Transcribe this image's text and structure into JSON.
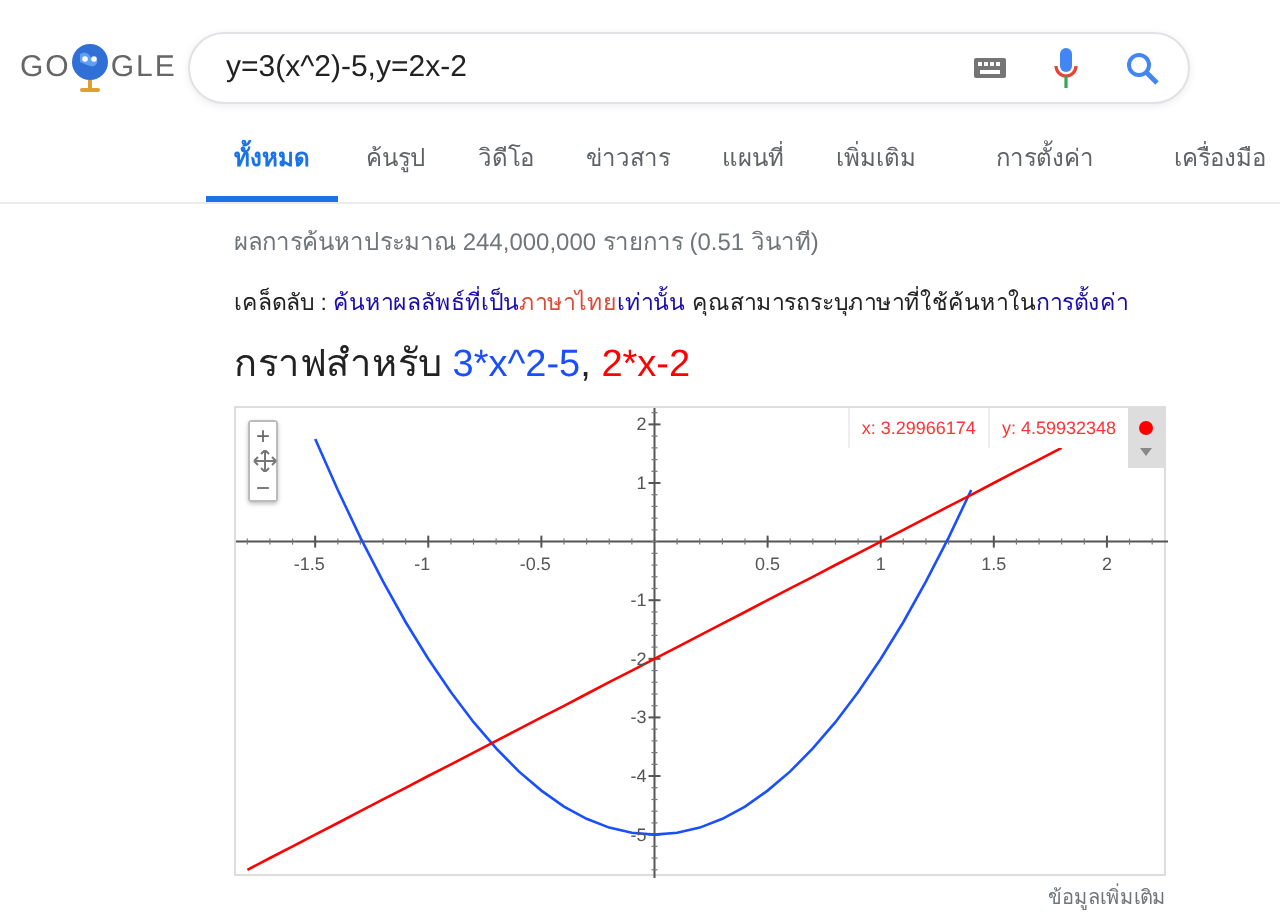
{
  "logo": {
    "left": "GO",
    "right": "GLE"
  },
  "search": {
    "value": "y=3(x^2)-5,y=2x-2"
  },
  "tabs": [
    {
      "label": "ทั้งหมด",
      "selected": true
    },
    {
      "label": "ค้นรูป",
      "selected": false
    },
    {
      "label": "วิดีโอ",
      "selected": false
    },
    {
      "label": "ข่าวสาร",
      "selected": false
    },
    {
      "label": "แผนที่",
      "selected": false
    },
    {
      "label": "เพิ่มเติม",
      "selected": false
    }
  ],
  "tools": [
    "การตั้งค่า",
    "เครื่องมือ"
  ],
  "result_stats": "ผลการค้นหาประมาณ 244,000,000 รายการ (0.51 วินาที)",
  "tip": {
    "label": "เคล็ดลับ : ",
    "link_before": "ค้นหาผลลัพธ์ที่เป็น",
    "link_highlight": "ภาษาไทย",
    "link_after": "เท่านั้น",
    "text": " คุณสามารถระบุภาษาที่ใช้ค้นหาใน",
    "settings_link": "การตั้งค่า"
  },
  "graph": {
    "heading": "กราฟสำหรับ",
    "separator": ", ",
    "zoom_in": "+",
    "zoom_out": "−",
    "cursor": {
      "x": "x: 3.29966174",
      "y": "y: 4.59932348"
    },
    "chart_data": {
      "type": "line",
      "x": [
        -1.8,
        -1.7,
        -1.6,
        -1.5,
        -1.4,
        -1.3,
        -1.2,
        -1.1,
        -1,
        -0.9,
        -0.8,
        -0.7,
        -0.6,
        -0.5,
        -0.4,
        -0.3,
        -0.2,
        -0.1,
        0,
        0.1,
        0.2,
        0.3,
        0.4,
        0.5,
        0.6,
        0.7,
        0.8,
        0.9,
        1,
        1.1,
        1.2,
        1.3,
        1.4,
        1.5,
        1.6,
        1.7,
        1.8
      ],
      "series": [
        {
          "name": "3*x^2-5",
          "color": "#1a4fff",
          "values": [
            null,
            null,
            null,
            1.75,
            0.88,
            0.07,
            -0.68,
            -1.37,
            -2,
            -2.57,
            -3.08,
            -3.53,
            -3.92,
            -4.25,
            -4.52,
            -4.73,
            -4.88,
            -4.97,
            -5,
            -4.97,
            -4.88,
            -4.73,
            -4.52,
            -4.25,
            -3.92,
            -3.53,
            -3.08,
            -2.57,
            -2,
            -1.37,
            -0.68,
            0.07,
            0.88,
            null,
            null,
            null,
            null
          ]
        },
        {
          "name": "2*x-2",
          "color": "#ff0000",
          "values": [
            -5.6,
            -5.4,
            -5.2,
            -5,
            -4.8,
            -4.6,
            -4.4,
            -4.2,
            -4,
            -3.8,
            -3.6,
            -3.4,
            -3.2,
            -3,
            -2.8,
            -2.6,
            -2.4,
            -2.2,
            -2,
            -1.8,
            -1.6,
            -1.4,
            -1.2,
            -1,
            -0.8,
            -0.6,
            -0.4,
            -0.2,
            0,
            0.2,
            0.4,
            0.6,
            0.8,
            1,
            1.2,
            1.4,
            1.6
          ]
        }
      ],
      "xlim": [
        -1.85,
        2.27
      ],
      "ylim": [
        -5.74,
        2.28
      ],
      "xticks": [
        -1.5,
        -1,
        -0.5,
        0.5,
        1,
        1.5,
        2
      ],
      "yticks": [
        2,
        1,
        -1,
        -2,
        -3,
        -4,
        -5
      ]
    },
    "more_info": "ข้อมูลเพิ่มเติม"
  }
}
